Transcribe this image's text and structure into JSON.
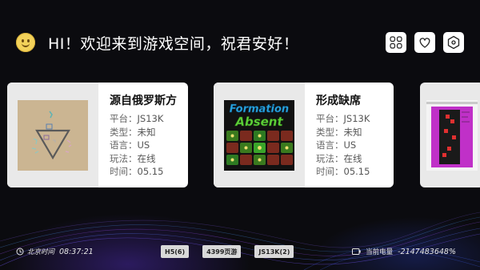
{
  "header": {
    "greeting": "HI！欢迎来到游戏空间，祝君安好！",
    "avatar_icon": "smiley-face-icon"
  },
  "top_icons": [
    {
      "name": "apps-grid-icon"
    },
    {
      "name": "heart-icon"
    },
    {
      "name": "settings-hexagon-icon"
    }
  ],
  "cards": [
    {
      "title": "源自俄罗斯方",
      "rows": [
        {
          "key": "平台：",
          "value": "JS13K"
        },
        {
          "key": "类型：",
          "value": "未知"
        },
        {
          "key": "语言：",
          "value": "US"
        },
        {
          "key": "玩法：",
          "value": "在线"
        },
        {
          "key": "时间：",
          "value": "05.15"
        }
      ]
    },
    {
      "title": "形成缺席",
      "thumb_text": [
        "Formation",
        "Absent"
      ],
      "rows": [
        {
          "key": "平台：",
          "value": "JS13K"
        },
        {
          "key": "类型：",
          "value": "未知"
        },
        {
          "key": "语言：",
          "value": "US"
        },
        {
          "key": "玩法：",
          "value": "在线"
        },
        {
          "key": "时间：",
          "value": "05.15"
        }
      ]
    }
  ],
  "footer": {
    "clock_label": "北京时间",
    "time": "08:37:21",
    "chips": [
      "H5(6)",
      "4399页游",
      "JS13K(2)"
    ],
    "battery_label": "当前电量",
    "battery_value": "-2147483648%"
  },
  "colors": {
    "background": "#0b0b0f",
    "card": "#ffffff",
    "chip": "#d9d9d9",
    "avatar": "#f3d25a",
    "formation_title": "#2aa6e0",
    "absent_title": "#5fd13a"
  }
}
